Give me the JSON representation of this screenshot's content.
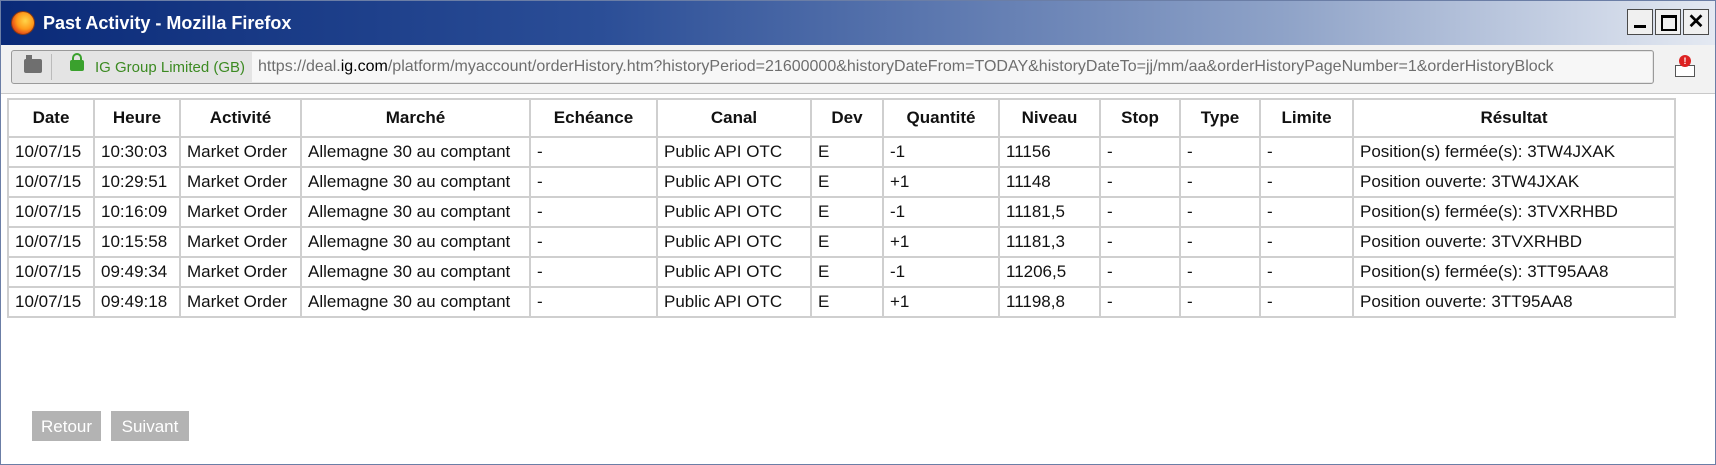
{
  "window": {
    "title": "Past Activity - Mozilla Firefox",
    "close_glyph": "✕"
  },
  "navbar": {
    "site_identity": "IG Group Limited (GB)",
    "url_prefix": "https://deal.",
    "url_host": "ig.com",
    "url_rest": "/platform/myaccount/orderHistory.htm?historyPeriod=21600000&historyDateFrom=TODAY&historyDateTo=jj/mm/aa&orderHistoryPageNumber=1&orderHistoryBlock",
    "icons": [
      "page-icon",
      "lock-icon",
      "notification-icon"
    ]
  },
  "table": {
    "columns": [
      "Date",
      "Heure",
      "Activité",
      "Marché",
      "Echéance",
      "Canal",
      "Dev",
      "Quantité",
      "Niveau",
      "Stop",
      "Type",
      "Limite",
      "Résultat"
    ],
    "rows": [
      [
        "10/07/15",
        "10:30:03",
        "Market Order",
        "Allemagne 30 au comptant",
        "-",
        "Public API OTC",
        "E",
        "-1",
        "11156",
        "-",
        "-",
        "-",
        "Position(s) fermée(s): 3TW4JXAK"
      ],
      [
        "10/07/15",
        "10:29:51",
        "Market Order",
        "Allemagne 30 au comptant",
        "-",
        "Public API OTC",
        "E",
        "+1",
        "11148",
        "-",
        "-",
        "-",
        "Position ouverte: 3TW4JXAK"
      ],
      [
        "10/07/15",
        "10:16:09",
        "Market Order",
        "Allemagne 30 au comptant",
        "-",
        "Public API OTC",
        "E",
        "-1",
        "11181,5",
        "-",
        "-",
        "-",
        "Position(s) fermée(s): 3TVXRHBD"
      ],
      [
        "10/07/15",
        "10:15:58",
        "Market Order",
        "Allemagne 30 au comptant",
        "-",
        "Public API OTC",
        "E",
        "+1",
        "11181,3",
        "-",
        "-",
        "-",
        "Position ouverte: 3TVXRHBD"
      ],
      [
        "10/07/15",
        "09:49:34",
        "Market Order",
        "Allemagne 30 au comptant",
        "-",
        "Public API OTC",
        "E",
        "-1",
        "11206,5",
        "-",
        "-",
        "-",
        "Position(s) fermée(s): 3TT95AA8"
      ],
      [
        "10/07/15",
        "09:49:18",
        "Market Order",
        "Allemagne 30 au comptant",
        "-",
        "Public API OTC",
        "E",
        "+1",
        "11198,8",
        "-",
        "-",
        "-",
        "Position ouverte: 3TT95AA8"
      ]
    ]
  },
  "pagination": {
    "prev_label": "Retour",
    "next_label": "Suivant"
  },
  "colors": {
    "titlebar_start": "#0a2a78",
    "secure_green": "#3c8a22",
    "button_disabled": "#b3b3b3"
  }
}
